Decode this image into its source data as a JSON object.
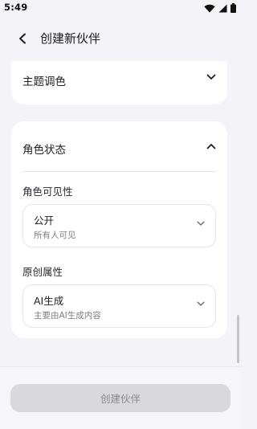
{
  "status_bar": {
    "time": "5:49"
  },
  "header": {
    "title": "创建新伙伴"
  },
  "sections": {
    "theme": {
      "title": "主题调色",
      "expanded": false
    },
    "status": {
      "title": "角色状态",
      "expanded": true,
      "visibility": {
        "label": "角色可见性",
        "value": "公开",
        "description": "所有人可见"
      },
      "originality": {
        "label": "原创属性",
        "value": "AI生成",
        "description": "主要由AI生成内容"
      }
    }
  },
  "footer": {
    "create_label": "创建伙伴",
    "create_enabled": false
  },
  "colors": {
    "background": "#f3f3f8",
    "card": "#ffffff",
    "button_disabled": "#d8d8dd",
    "button_text_disabled": "#8a8a90"
  }
}
